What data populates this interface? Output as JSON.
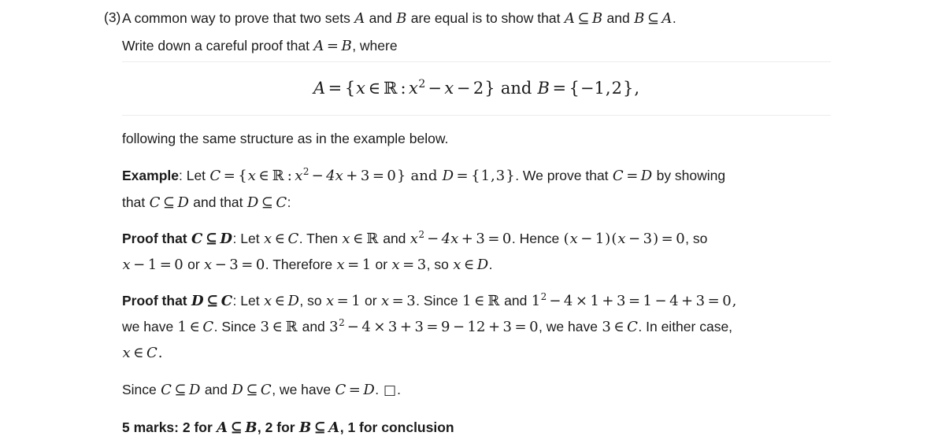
{
  "document": {
    "question_number": "(3)",
    "intro": {
      "line1_a": "A common way to prove that two sets ",
      "var_A": "A",
      "line1_b": " and ",
      "var_B": "B",
      "line1_c": " are equal is to show that ",
      "sub_AB_a": "A",
      "subset_sym": "⊆",
      "sub_AB_b": "B",
      "line1_d": " and ",
      "sub_BA_a": "B",
      "sub_BA_b": "A",
      "line1_end": ".",
      "line2_a": "Write down a careful proof that ",
      "eq_A": "A",
      "equals": "=",
      "eq_B": "B",
      "line2_end": ", where"
    },
    "display_equation": {
      "lhs": "A",
      "equals": "=",
      "set_open": "{",
      "var_x": "x",
      "in_sym": "∈",
      "reals": "ℝ",
      "colon": ":",
      "x2": "x",
      "sup2": "2",
      "minus1": "−",
      "x_again": "x",
      "minus2": "−",
      "two": "2",
      "set_close": "}",
      "and_word": "and",
      "rhs_B": "B",
      "equals2": "=",
      "rhs_set_open": "{",
      "neg_one": "−1",
      "comma": ",",
      "rhs_two": "2",
      "rhs_set_close": "}",
      "trailing_comma": ","
    },
    "following_line": "following the same structure as in the example below.",
    "example": {
      "label": "Example",
      "colon_let": ": Let ",
      "var_C": "C",
      "equals": "=",
      "set_open": "{",
      "var_x": "x",
      "in_sym": "∈",
      "reals": "ℝ",
      "colon": ":",
      "x2": "x",
      "sup2": "2",
      "minus": "−",
      "four_x": "4x",
      "plus": "+",
      "three": "3",
      "eq2": "=",
      "zero": "0",
      "set_close": "}",
      "and_word": " and ",
      "var_D": "D",
      "equals3": "=",
      "d_set_open": "{",
      "one": "1",
      "comma": ",",
      "three2": "3",
      "d_set_close": "}",
      "period_we_prove": ".  We prove that ",
      "C2": "C",
      "equals4": "=",
      "D2": "D",
      "by_showing": " by showing",
      "line2_that": "that ",
      "C3": "C",
      "subset": "⊆",
      "D3": "D",
      "and_that": " and that ",
      "D4": "D",
      "subset2": "⊆",
      "C4": "C",
      "line2_end": ":"
    },
    "proof_cd": {
      "label": "Proof that ",
      "C": "C",
      "subset": "⊆",
      "D": "D",
      "colon_let": ": Let ",
      "x1": "x",
      "in1": "∈",
      "C2": "C",
      "then": ". Then ",
      "x2": "x",
      "in2": "∈",
      "reals": "ℝ",
      "and_word": " and ",
      "x_sq": "x",
      "sup2": "2",
      "minus": "−",
      "four_x": "4x",
      "plus": "+",
      "three": "3",
      "equals": "=",
      "zero": "0",
      "hence": ". Hence ",
      "paren_open": "(",
      "x3": "x",
      "minus2": "−",
      "one": "1",
      "paren_close": ")",
      "paren_open2": "(",
      "x4": "x",
      "minus3": "−",
      "three2": "3",
      "paren_close2": ")",
      "equals2": "=",
      "zero2": "0",
      "so": ", so",
      "line2_x": "x",
      "line2_minus": "−",
      "line2_one": "1",
      "line2_eq": "=",
      "line2_zero": "0",
      "line2_or": " or ",
      "line2_x2": "x",
      "line2_minus2": "−",
      "line2_three": "3",
      "line2_eq2": "=",
      "line2_zero2": "0",
      "line2_therefore": ". Therefore ",
      "line2_x3": "x",
      "line2_eq3": "=",
      "line2_one2": "1",
      "line2_or2": " or ",
      "line2_x4": "x",
      "line2_eq4": "=",
      "line2_three2": "3",
      "line2_so": ", so ",
      "line2_x5": "x",
      "line2_in": "∈",
      "line2_D": "D",
      "line2_end": "."
    },
    "proof_dc": {
      "label": "Proof that ",
      "D": "D",
      "subset": "⊆",
      "C": "C",
      "colon_let": ": Let ",
      "x1": "x",
      "in1": "∈",
      "D2": "D",
      "so_x": ", so ",
      "x2": "x",
      "eq1": "=",
      "one": "1",
      "or_word": " or ",
      "x3": "x",
      "eq2": "=",
      "three": "3",
      "since": ". Since ",
      "one2": "1",
      "in2": "∈",
      "reals": "ℝ",
      "and_word": " and ",
      "one_sq": "1",
      "sup2": "2",
      "minus": "−",
      "four": "4",
      "times": "×",
      "one3": "1",
      "plus": "+",
      "three2": "3",
      "eq3": "=",
      "one4": "1",
      "minus2": "−",
      "four2": "4",
      "plus2": "+",
      "three3": "3",
      "eq4": "=",
      "zero": "0",
      "comma": ",",
      "l2_we_have": "we have ",
      "l2_one": "1",
      "l2_in": "∈",
      "l2_C": "C",
      "l2_since": ". Since ",
      "l2_three": "3",
      "l2_in2": "∈",
      "l2_reals": "ℝ",
      "l2_and": " and ",
      "l2_three_sq": "3",
      "l2_sup2": "2",
      "l2_minus": "−",
      "l2_four": "4",
      "l2_times": "×",
      "l2_three2": "3",
      "l2_plus": "+",
      "l2_three3": "3",
      "l2_eq": "=",
      "l2_nine": "9",
      "l2_minus2": "−",
      "l2_twelve": "12",
      "l2_plus2": "+",
      "l2_three4": "3",
      "l2_eq2": "=",
      "l2_zero": "0",
      "l2_we_have2": ", we have ",
      "l2_three5": "3",
      "l2_in3": "∈",
      "l2_C2": "C",
      "l2_either": ". In either case,",
      "l3_x": "x",
      "l3_in": "∈",
      "l3_C": "C",
      "l3_end": "."
    },
    "conclusion": {
      "since": "Since ",
      "C": "C",
      "subset": "⊆",
      "D": "D",
      "and_word": " and ",
      "D2": "D",
      "subset2": "⊆",
      "C2": "C",
      "we_have": ", we have ",
      "C3": "C",
      "equals": "=",
      "D3": "D",
      "period": ". ",
      "qed": "□",
      "end": "."
    },
    "marks": {
      "prefix": "5 marks: 2 for ",
      "A": "A",
      "subset": "⊆",
      "B": "B",
      "mid": ", 2 for ",
      "B2": "B",
      "subset2": "⊆",
      "A2": "A",
      "suffix": ", 1 for conclusion"
    }
  },
  "colors": {
    "text": "#1b1b1b",
    "rule": "#ececee",
    "background": "#ffffff"
  }
}
